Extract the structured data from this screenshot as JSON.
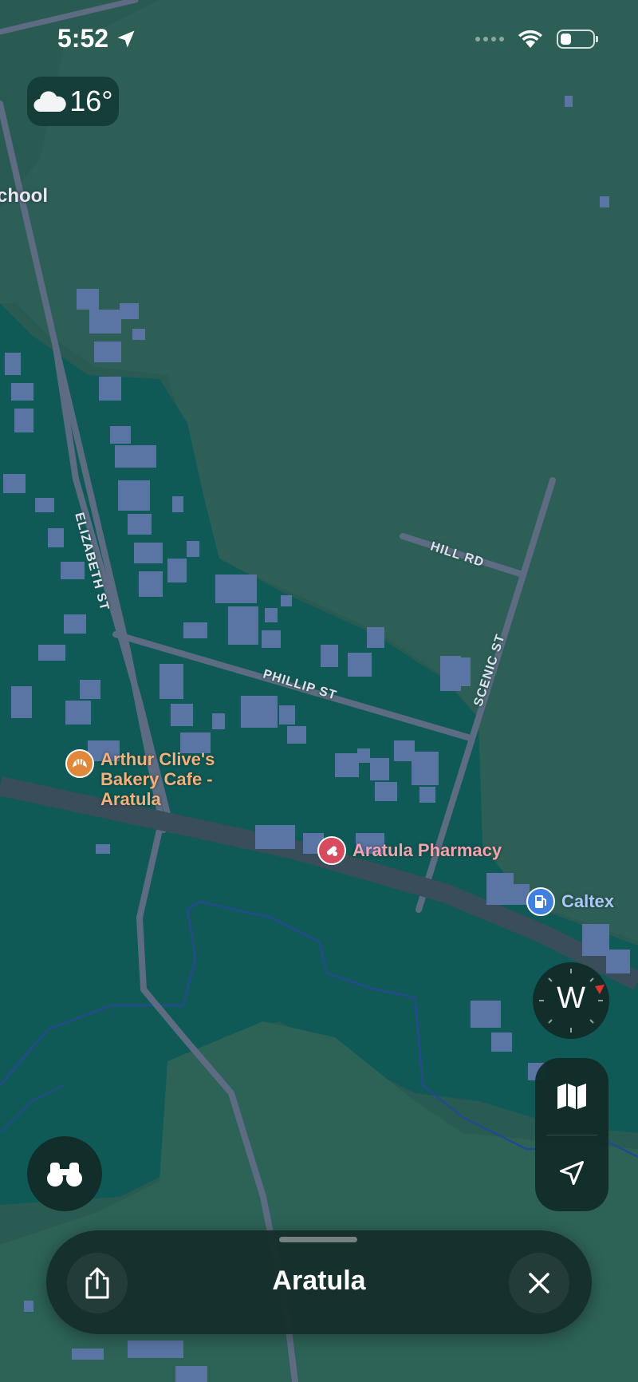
{
  "status_bar": {
    "time": "5:52",
    "battery_fraction": 0.35
  },
  "weather": {
    "icon": "cloud-icon",
    "temperature": "16°"
  },
  "map": {
    "partial_label": "chool",
    "streets": [
      {
        "name": "ELIZABETH ST"
      },
      {
        "name": "HILL RD"
      },
      {
        "name": "PHILLIP ST"
      },
      {
        "name": "SCENIC ST"
      }
    ],
    "pois": [
      {
        "name": "Arthur Clive's\nBakery Cafe -\nAratula",
        "icon": "croissant-icon",
        "color": "#e0873a",
        "text_color": "#f2b07b"
      },
      {
        "name": "Aratula Pharmacy",
        "icon": "pills-icon",
        "color": "#d84a5e",
        "text_color": "#f1a3ae"
      },
      {
        "name": "Caltex",
        "icon": "fuel-pump-icon",
        "color": "#3f7fe0",
        "text_color": "#a9c8f5"
      }
    ],
    "compass_heading": "W"
  },
  "controls": {
    "map_mode_icon": "map-icon",
    "location_icon": "location-arrow-icon",
    "look_around_icon": "binoculars-icon"
  },
  "place_card": {
    "title": "Aratula",
    "share_icon": "share-icon",
    "close_icon": "close-icon"
  }
}
